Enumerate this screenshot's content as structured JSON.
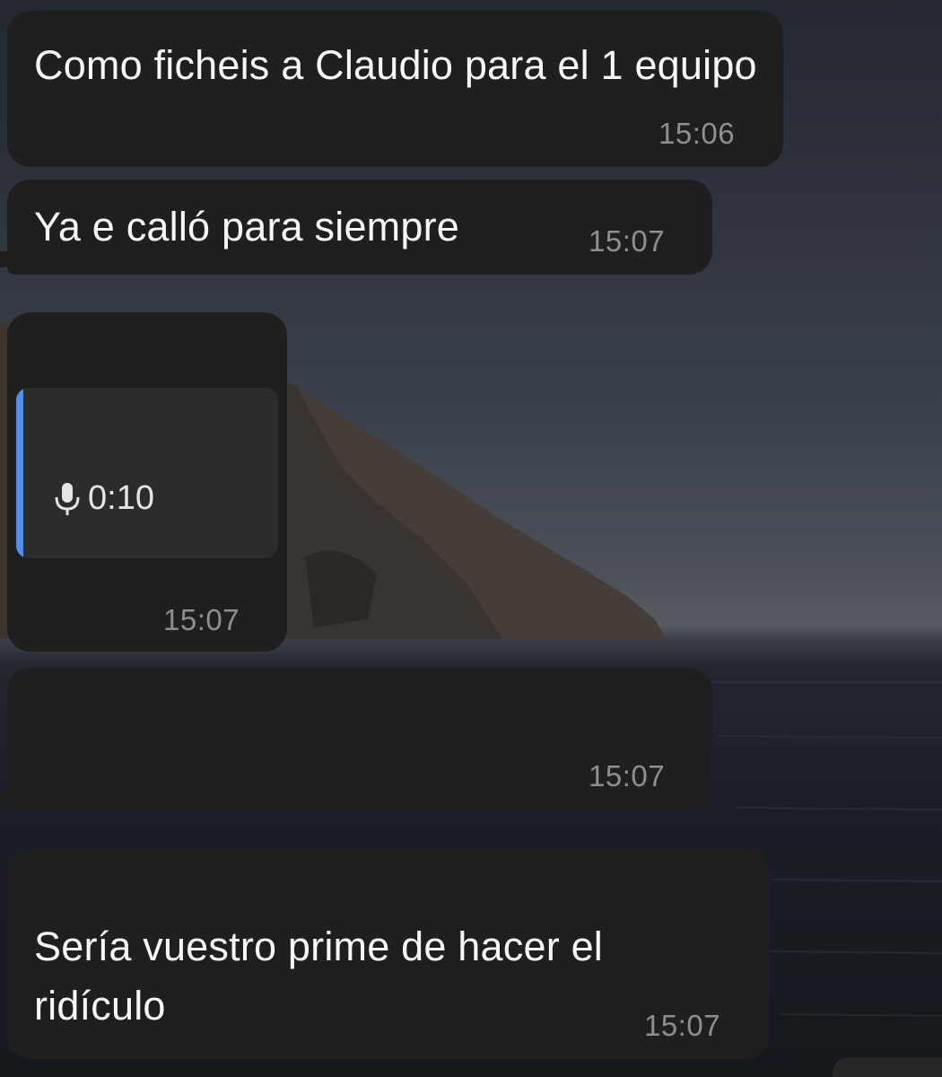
{
  "messages": [
    {
      "id": "m1",
      "text": "Como ficheis a Claudio para el 1 equipo",
      "time": "15:06"
    },
    {
      "id": "m2",
      "text": "Ya e calló para siempre",
      "time": "15:07"
    },
    {
      "id": "m3",
      "type": "voice",
      "duration": "0:10",
      "icon": "microphone-icon",
      "time": "15:07"
    },
    {
      "id": "m4",
      "text": "",
      "time": "15:07"
    },
    {
      "id": "m5",
      "text": "Sería vuestro prime de hacer el ridículo",
      "time": "15:07"
    }
  ],
  "colors": {
    "bubble": "#1f1f1f",
    "timestamp": "#8e8e93",
    "quote_accent": "#4f8df0"
  }
}
